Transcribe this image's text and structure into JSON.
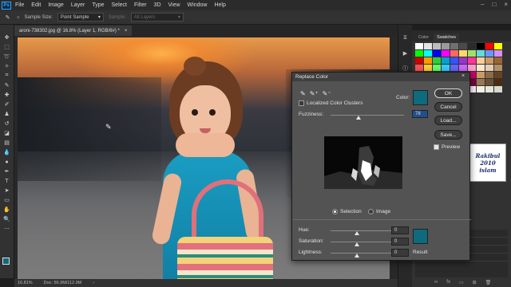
{
  "app": {
    "logo": "Ps"
  },
  "menu": [
    "File",
    "Edit",
    "Image",
    "Layer",
    "Type",
    "Select",
    "Filter",
    "3D",
    "View",
    "Window",
    "Help"
  ],
  "options_bar": {
    "sample_size_label": "Sample Size:",
    "sample_size_value": "Point Sample",
    "sample_label": "Sample:",
    "sample_value": "All Layers"
  },
  "document": {
    "tab_title": "aroni-738302.jpg @ 16.8% (Layer 1, RGB/8#) *",
    "tab_close": "×"
  },
  "status": {
    "zoom": "16.81%",
    "doc_size": "Doc: 56.9M/112.9M"
  },
  "panel": {
    "tabs": [
      "Color",
      "Swatches"
    ],
    "active_tab": "Swatches",
    "swatch_colors": [
      "#ffffff",
      "#e6e6e6",
      "#bdbdbd",
      "#9a9a9a",
      "#707070",
      "#4a4a4a",
      "#2b2b2b",
      "#000000",
      "#ff0000",
      "#ffff00",
      "#00ff00",
      "#00ffff",
      "#0000ff",
      "#ff00ff",
      "#ff6666",
      "#ffd966",
      "#9fe06a",
      "#66d9d9",
      "#6699ff",
      "#d98cff",
      "#cc0000",
      "#ff9900",
      "#33cc33",
      "#00a3cc",
      "#3355ff",
      "#9933cc",
      "#ff3399",
      "#ffcc99",
      "#cc9966",
      "#996633",
      "#ff5050",
      "#ffcc33",
      "#66ff66",
      "#33ccff",
      "#6666ff",
      "#cc66ff",
      "#ff99cc",
      "#ffe6cc",
      "#e6ccb3",
      "#b38f66",
      "#990000",
      "#cc6600",
      "#339933",
      "#006699",
      "#003399",
      "#660099",
      "#cc0066",
      "#cc9966",
      "#8c6b4a",
      "#664422",
      "#660000",
      "#994c00",
      "#1f661f",
      "#004466",
      "#001f66",
      "#440066",
      "#800040",
      "#997755",
      "#6b5033",
      "#4a2e14",
      "#ffeeee",
      "#fff5e6",
      "#eeffee",
      "#e6f7ff",
      "#eeeeff",
      "#f7eeff",
      "#ffeef7",
      "#f2f2e6",
      "#e6e6d9",
      "#d9d9cc"
    ],
    "footer_icons": [
      "folder-icon",
      "new-icon",
      "trash-icon"
    ]
  },
  "watermark": {
    "line1": "Rakibul",
    "line2": "2010",
    "line3": "islam"
  },
  "dialog": {
    "title": "Replace Color",
    "close": "×",
    "localized_label": "Localized Color Clusters",
    "color_label": "Color:",
    "fuzziness_label": "Fuzziness:",
    "fuzziness_value": "78",
    "selection_label": "Selection",
    "image_label": "Image",
    "mode": "Selection",
    "hue_label": "Hue:",
    "hue_value": "0",
    "saturation_label": "Saturation:",
    "saturation_value": "0",
    "lightness_label": "Lightness:",
    "lightness_value": "0",
    "result_label": "Result",
    "buttons": {
      "ok": "OK",
      "cancel": "Cancel",
      "load": "Load...",
      "save": "Save..."
    },
    "preview_label": "Preview",
    "preview_checked": true,
    "sample_color": "#0e6a7d",
    "result_color": "#0e6a7d"
  },
  "colors": {
    "foreground": "#0e6a7d",
    "background": "#ffffff"
  }
}
